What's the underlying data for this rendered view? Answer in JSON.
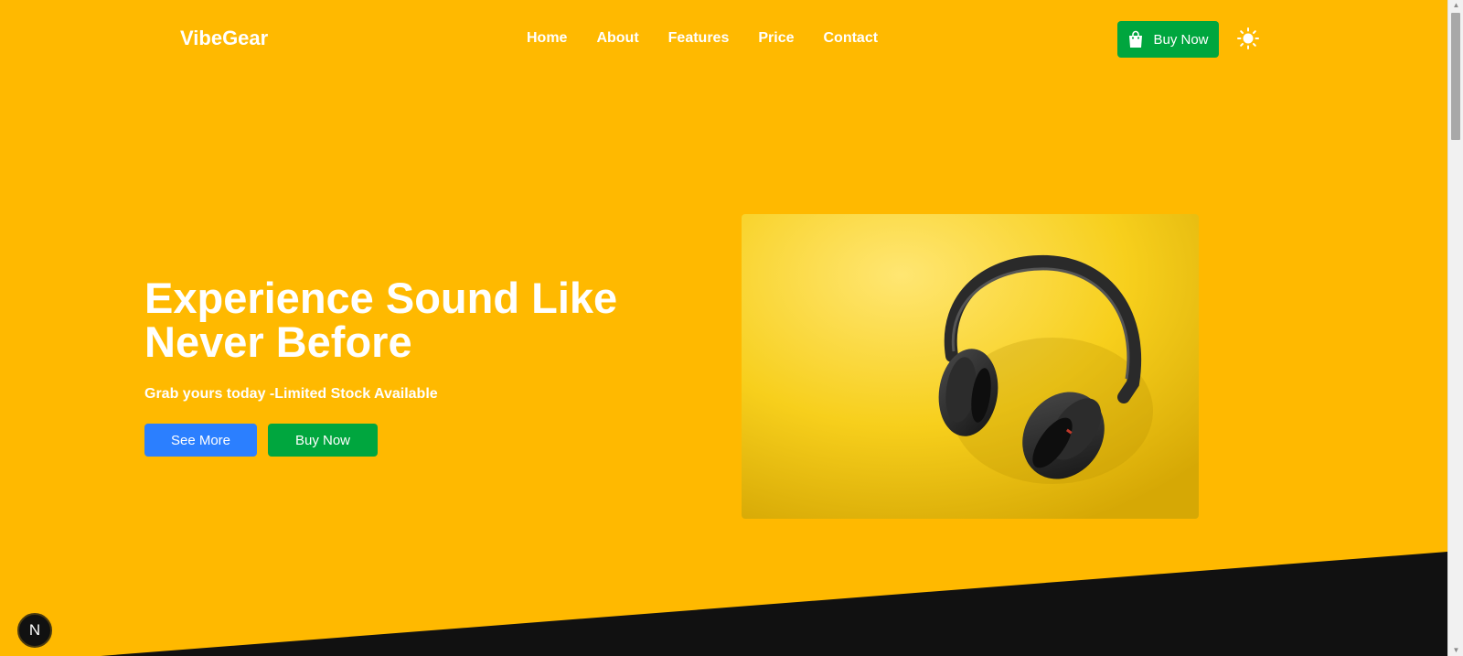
{
  "brand": "VibeGear",
  "nav": {
    "items": [
      "Home",
      "About",
      "Features",
      "Price",
      "Contact"
    ],
    "buy_label": "Buy Now"
  },
  "hero": {
    "title_line1": "Experience Sound Like",
    "title_line2": "Never Before",
    "subtitle": "Grab yours today -Limited Stock Available",
    "see_more_label": "See More",
    "buy_label": "Buy Now"
  },
  "badge": "N",
  "colors": {
    "background": "#ffb900",
    "dark": "#111111",
    "primary_blue": "#2b7fff",
    "primary_green": "#00a63e",
    "text": "#ffffff"
  },
  "icons": {
    "nav_buy": "shopping-bag-icon",
    "theme_toggle": "sun-icon"
  }
}
